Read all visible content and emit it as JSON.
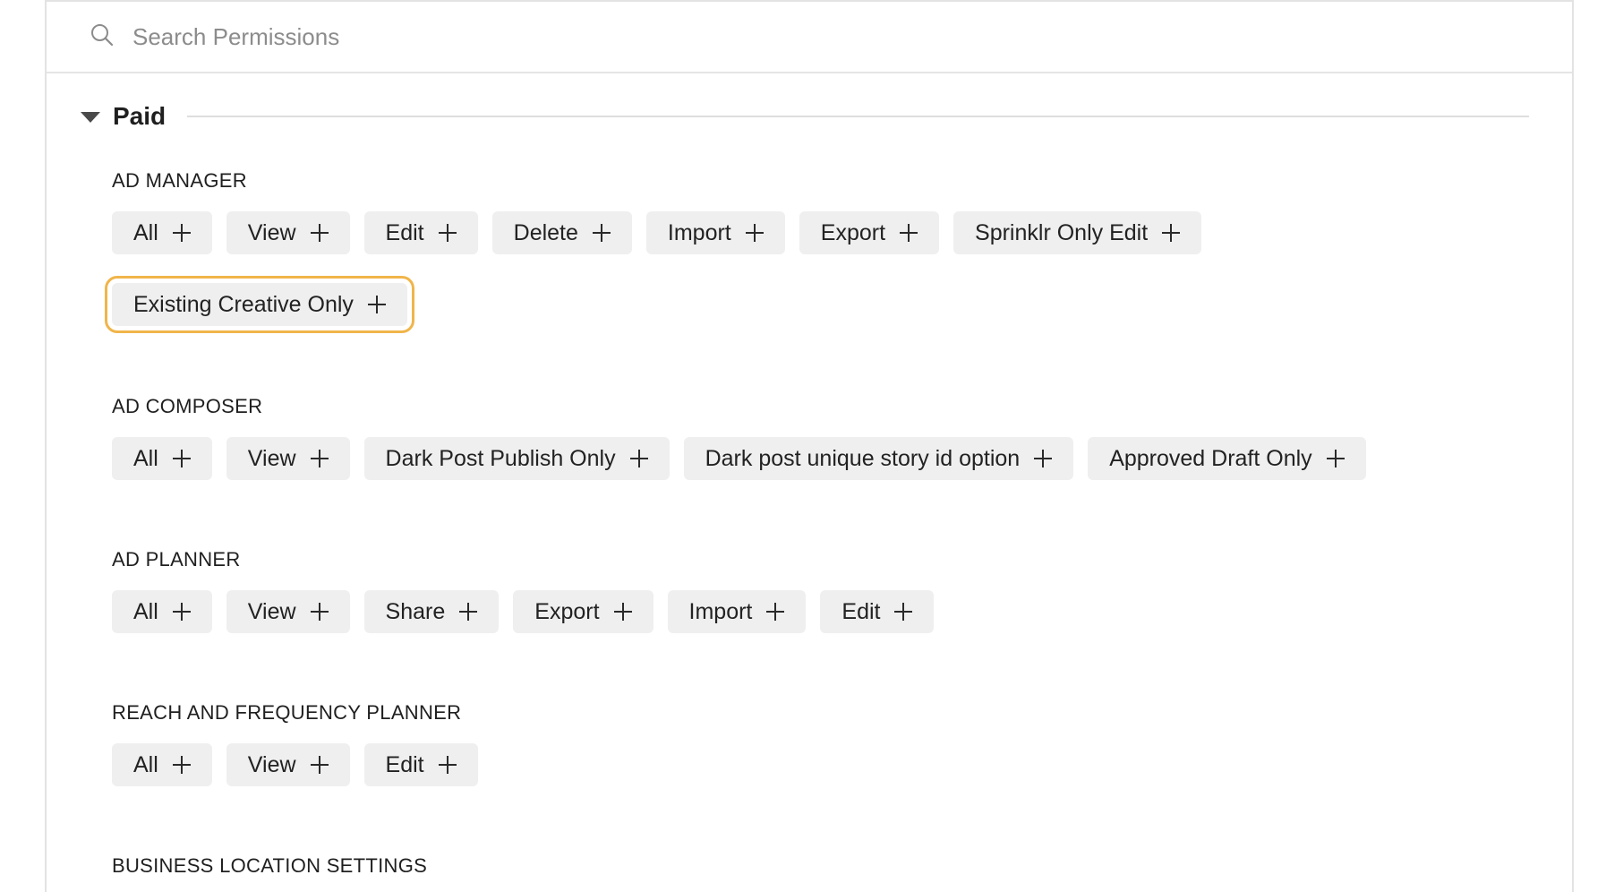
{
  "search": {
    "placeholder": "Search Permissions"
  },
  "section": {
    "title": "Paid"
  },
  "groups": [
    {
      "title": "AD MANAGER",
      "rows": [
        [
          "All",
          "View",
          "Edit",
          "Delete",
          "Import",
          "Export",
          "Sprinklr Only Edit"
        ],
        [
          "Existing Creative Only"
        ]
      ]
    },
    {
      "title": "AD COMPOSER",
      "rows": [
        [
          "All",
          "View",
          "Dark Post Publish Only",
          "Dark post unique story id option",
          "Approved Draft Only"
        ]
      ]
    },
    {
      "title": "AD PLANNER",
      "rows": [
        [
          "All",
          "View",
          "Share",
          "Export",
          "Import",
          "Edit"
        ]
      ]
    },
    {
      "title": "REACH AND FREQUENCY PLANNER",
      "rows": [
        [
          "All",
          "View",
          "Edit"
        ]
      ]
    },
    {
      "title": "BUSINESS LOCATION SETTINGS",
      "rows": []
    }
  ],
  "focused_chip": "Existing Creative Only",
  "colors": {
    "focus_outline": "#f0b54a",
    "chip_bg": "#efefef"
  }
}
